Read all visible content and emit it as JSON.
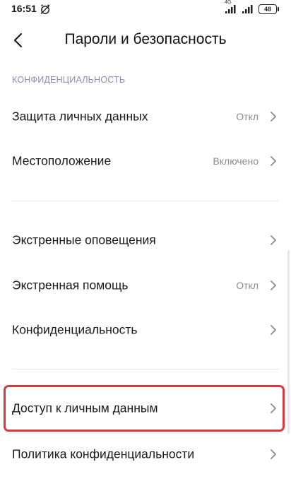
{
  "status_bar": {
    "time": "16:51",
    "network": "4G",
    "battery": "48"
  },
  "header": {
    "title": "Пароли и безопасность"
  },
  "section": {
    "title": "КОНФИДЕНЦИАЛЬНОСТЬ"
  },
  "rows": [
    {
      "label": "Защита личных данных",
      "value": "Откл"
    },
    {
      "label": "Местоположение",
      "value": "Включено"
    },
    {
      "label": "Экстренные оповещения",
      "value": ""
    },
    {
      "label": "Экстренная помощь",
      "value": "Откл"
    },
    {
      "label": "Конфиденциальность",
      "value": ""
    },
    {
      "label": "Доступ к личным данным",
      "value": ""
    },
    {
      "label": "Политика конфиденциальности",
      "value": ""
    }
  ],
  "colors": {
    "highlight": "#d9393b",
    "section_header": "#8a8fae"
  }
}
